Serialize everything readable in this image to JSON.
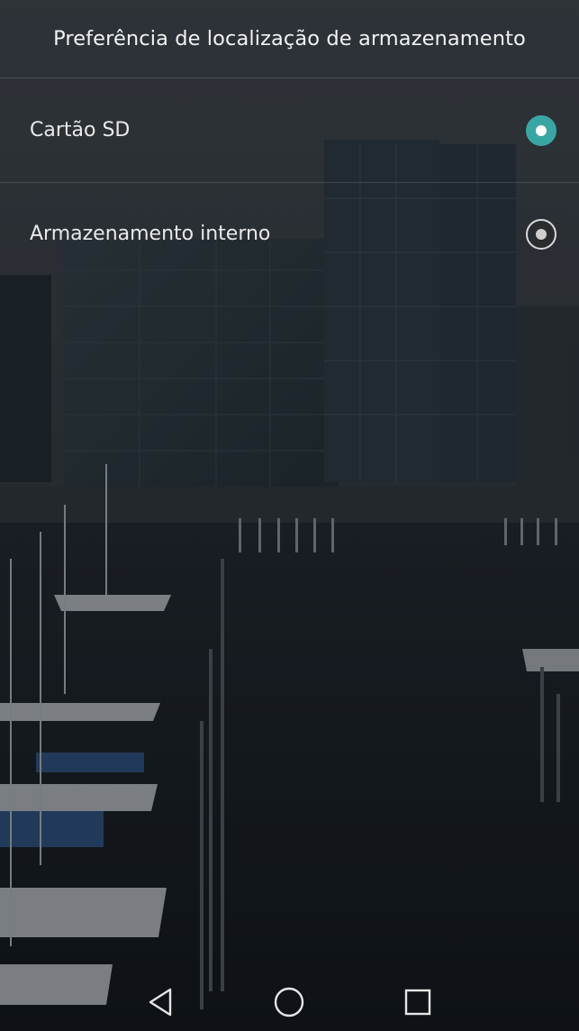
{
  "dialog": {
    "title": "Preferência de localização de armazenamento",
    "options": [
      {
        "label": "Cartão SD",
        "selected": true
      },
      {
        "label": "Armazenamento interno",
        "selected": false
      }
    ],
    "accent_color": "#3aa6a4"
  },
  "navbar": {
    "back_icon": "back-triangle-icon",
    "home_icon": "home-circle-icon",
    "recents_icon": "recents-square-icon"
  }
}
